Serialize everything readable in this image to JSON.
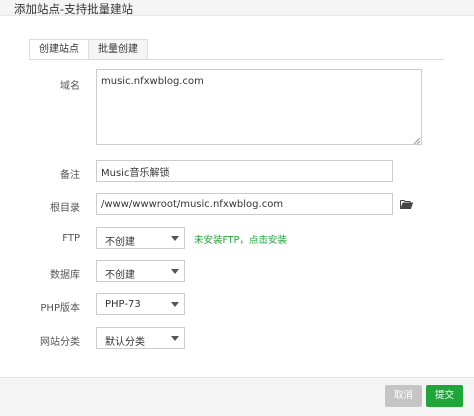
{
  "dialog": {
    "title": "添加站点-支持批量建站"
  },
  "tabs": [
    {
      "label": "创建站点",
      "active": true
    },
    {
      "label": "批量创建",
      "active": false
    }
  ],
  "form": {
    "domain": {
      "label": "域名",
      "value": "music.nfxwblog.com"
    },
    "remark": {
      "label": "备注",
      "value": "Music音乐解锁"
    },
    "root": {
      "label": "根目录",
      "value": "/www/wwwroot/music.nfxwblog.com",
      "icon": "folder-icon"
    },
    "ftp": {
      "label": "FTP",
      "selected": "不创建",
      "note": "未安装FTP，点击安装"
    },
    "database": {
      "label": "数据库",
      "selected": "不创建"
    },
    "php": {
      "label": "PHP版本",
      "selected": "PHP-73"
    },
    "category": {
      "label": "网站分类",
      "selected": "默认分类"
    }
  },
  "footer": {
    "cancel_label": "取消",
    "submit_label": "提交"
  },
  "colors": {
    "accent": "#20a53a",
    "cancel": "#c5c5c5"
  }
}
